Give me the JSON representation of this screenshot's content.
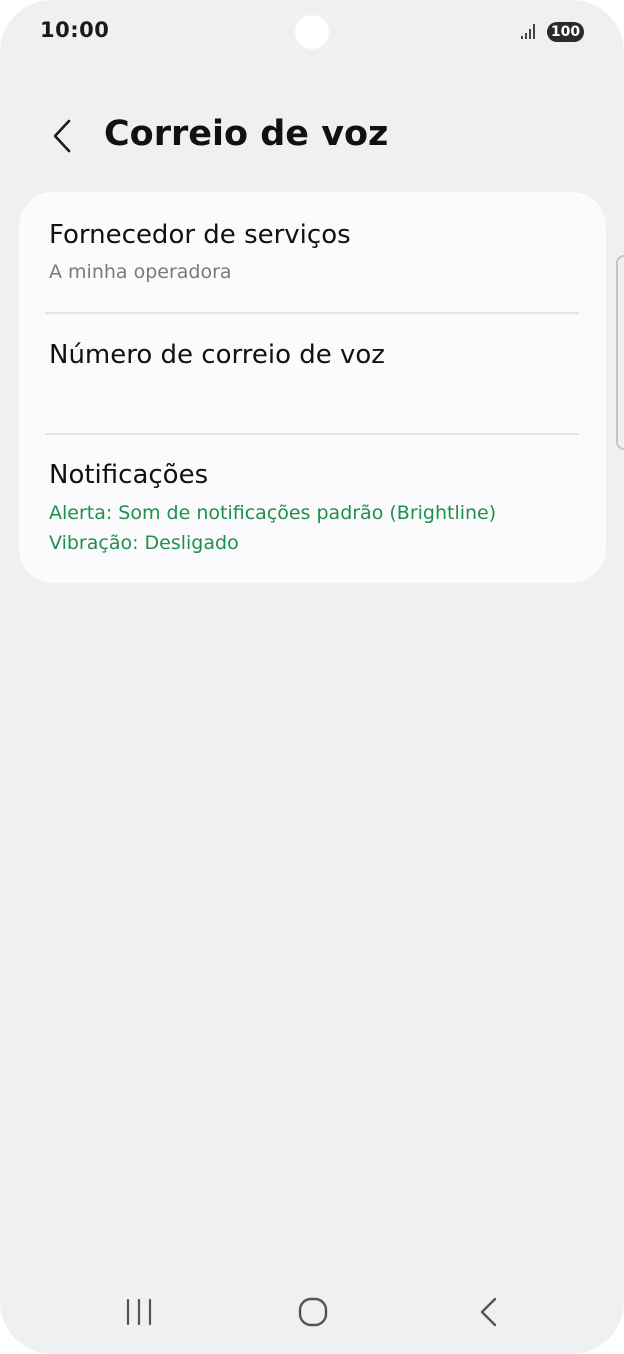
{
  "status_bar": {
    "time": "10:00",
    "battery": "100",
    "signal_icon": "signal-icon"
  },
  "header": {
    "title": "Correio de voz",
    "back_icon": "chevron-left-icon"
  },
  "settings": {
    "items": [
      {
        "title": "Fornecedor de serviços",
        "subtitle": "A minha operadora"
      },
      {
        "title": "Número de correio de voz"
      },
      {
        "title": "Notificações",
        "subtitle_lines": [
          "Alerta: Som de notificações padrão (Brightline)",
          "Vibração: Desligado"
        ]
      }
    ]
  },
  "nav_bar": {
    "icons": [
      "recent-apps-icon",
      "home-icon",
      "back-icon"
    ]
  },
  "colors": {
    "background": "#f0f0f3",
    "card": "#fbfbfd",
    "accent_green": "#1f8f4e",
    "subtitle_grey": "#7a7a7a"
  }
}
